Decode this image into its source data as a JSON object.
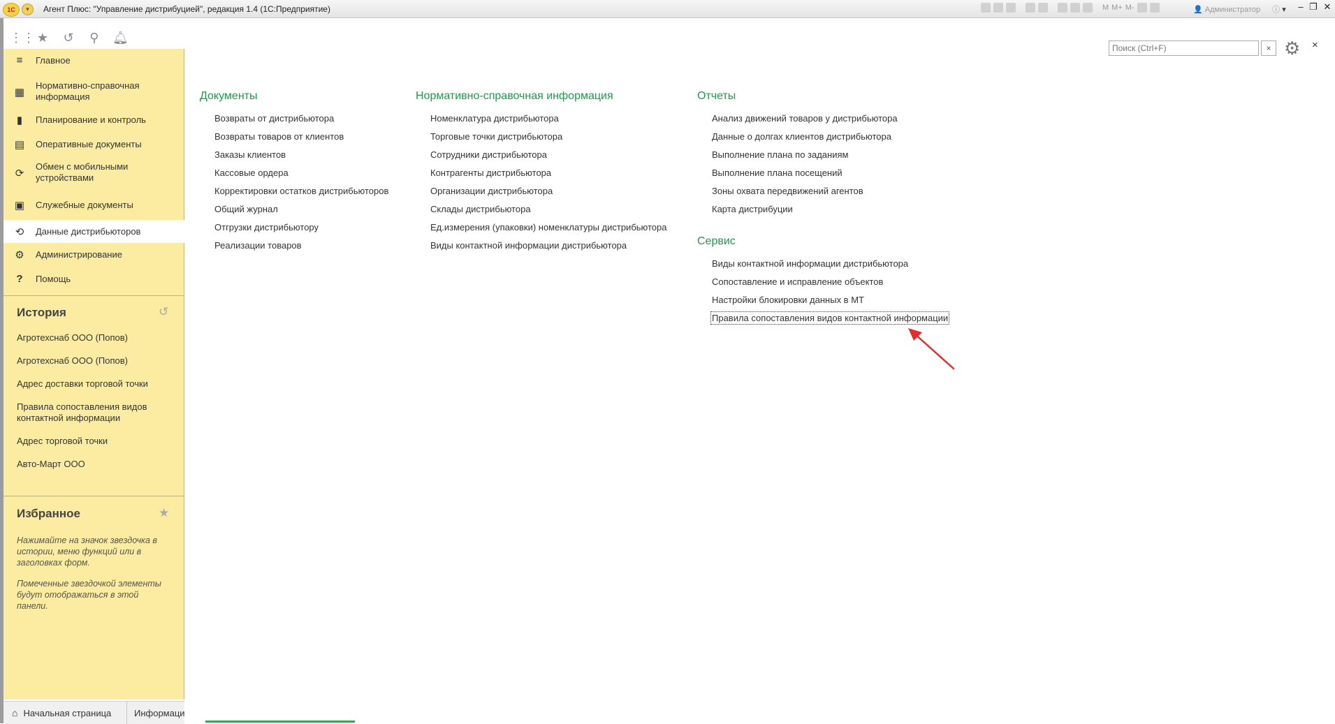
{
  "titlebar": {
    "logo": "1С",
    "title": "Агент Плюс: \"Управление дистрибуцией\", редакция 1.4  (1С:Предприятие)",
    "m_label": "M",
    "mplus_label": "M+",
    "mminus_label": "M-",
    "user": "Администратор",
    "minimize": "–",
    "restore": "❐",
    "close": "✕"
  },
  "sections": [
    {
      "label": "Главное",
      "icon": "menu-lines-icon"
    },
    {
      "label": "Нормативно-справочная информация",
      "icon": "table-icon"
    },
    {
      "label": "Планирование и контроль",
      "icon": "bar-chart-icon"
    },
    {
      "label": "Оперативные документы",
      "icon": "documents-icon"
    },
    {
      "label": "Обмен с мобильными устройствами",
      "icon": "sync-icon"
    },
    {
      "label": "Служебные документы",
      "icon": "service-docs-icon"
    },
    {
      "label": "Данные дистрибьюторов",
      "icon": "distributor-data-icon"
    },
    {
      "label": "Администрирование",
      "icon": "gear-icon"
    },
    {
      "label": "Помощь",
      "icon": "question-icon"
    }
  ],
  "history": {
    "title": "История",
    "items": [
      "Агротехснаб ООО (Попов)",
      "Агротехснаб ООО (Попов)",
      "Адрес доставки торговой точки",
      "Правила сопоставления видов контактной информации",
      "Адрес торговой точки",
      "Авто-Март ООО"
    ]
  },
  "favorites": {
    "title": "Избранное",
    "note1": "Нажимайте на значок звездочка в истории, меню функций или в заголовках форм.",
    "note2": "Помеченные звездочкой элементы будут отображаться в этой панели."
  },
  "search": {
    "placeholder": "Поиск (Ctrl+F)",
    "clear": "×"
  },
  "main_close": "×",
  "groups": {
    "documents": {
      "title": "Документы",
      "items": [
        "Возвраты от дистрибьютора",
        "Возвраты товаров от клиентов",
        "Заказы клиентов",
        "Кассовые ордера",
        "Корректировки остатков дистрибьюторов",
        "Общий журнал",
        "Отгрузки дистрибьютору",
        "Реализации товаров"
      ]
    },
    "nsi": {
      "title": "Нормативно-справочная информация",
      "items": [
        "Номенклатура дистрибьютора",
        "Торговые точки дистрибьютора",
        "Сотрудники дистрибьютора",
        "Контрагенты дистрибьютора",
        "Организации дистрибьютора",
        "Склады дистрибьютора",
        "Ед.измерения (упаковки)  номенклатуры дистрибьютора",
        "Виды контактной информации дистрибьютора"
      ]
    },
    "reports": {
      "title": "Отчеты",
      "items": [
        "Анализ движений товаров у дистрибьютора",
        "Данные о долгах клиентов дистрибьютора",
        "Выполнение плана по заданиям",
        "Выполнение плана посещений",
        "Зоны охвата передвижений агентов",
        "Карта дистрибуции"
      ]
    },
    "service": {
      "title": "Сервис",
      "items": [
        "Виды контактной информации дистрибьютора",
        "Сопоставление и исправление объектов",
        "Настройки блокировки данных в МТ",
        "Правила сопоставления видов контактной информации"
      ]
    }
  },
  "bottom_tabs": [
    "Начальная страница",
    "Информация"
  ],
  "colors": {
    "panel": "#fbeca1",
    "group_title": "#1f9a4b",
    "arrow": "#e0302a"
  }
}
